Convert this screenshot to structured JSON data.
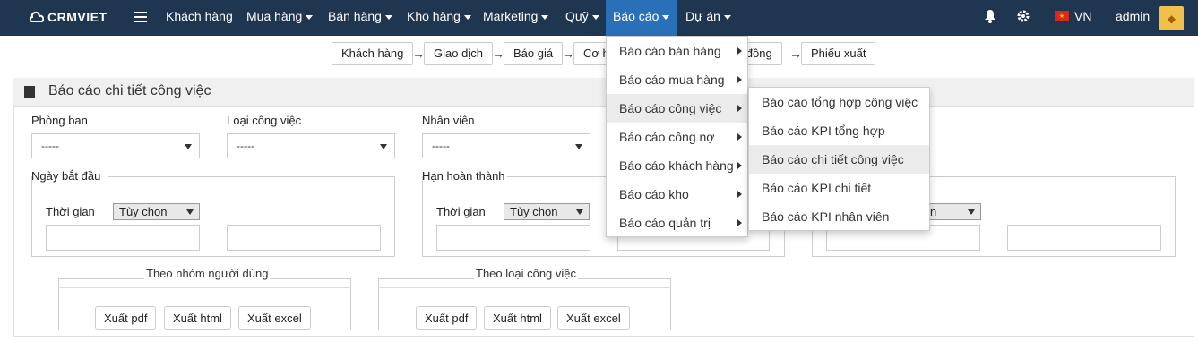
{
  "brand": {
    "name": "CRMVIET"
  },
  "nav": {
    "customers": "Khách hàng",
    "purchasing": "Mua hàng",
    "sales": "Bán hàng",
    "warehouse": "Kho hàng",
    "marketing": "Marketing",
    "fund": "Quỹ",
    "reports": "Báo cáo",
    "projects": "Dự án"
  },
  "topright": {
    "lang": "VN",
    "user": "admin"
  },
  "steps": [
    "Khách hàng",
    "Giao dịch",
    "Báo giá",
    "Cơ hội",
    "Hợp đồng",
    "Phiếu xuất"
  ],
  "page": {
    "title": "Báo cáo chi tiết công việc"
  },
  "form": {
    "department_label": "Phòng ban",
    "department_value": "-----",
    "work_type_label": "Loại công việc",
    "work_type_value": "-----",
    "employee_label": "Nhân viên",
    "employee_value": "-----",
    "start_date_label": "Ngày bắt đầu",
    "due_date_label": "Hạn hoàn thành",
    "time_label": "Thời gian",
    "time_option": "Tùy chọn",
    "time_option_partial": "chọn"
  },
  "export_groups": [
    {
      "title": "Theo nhóm người dùng",
      "pdf": "Xuất pdf",
      "html": "Xuất html",
      "excel": "Xuất excel"
    },
    {
      "title": "Theo loại công việc",
      "pdf": "Xuất pdf",
      "html": "Xuất html",
      "excel": "Xuất excel"
    }
  ],
  "reports_menu": [
    "Báo cáo bán hàng",
    "Báo cáo mua hàng",
    "Báo cáo công việc",
    "Báo cáo công nợ",
    "Báo cáo khách hàng",
    "Báo cáo kho",
    "Báo cáo quản trị"
  ],
  "work_submenu": [
    "Báo cáo tổng hợp công việc",
    "Báo cáo KPI tổng hợp",
    "Báo cáo chi tiết công việc",
    "Báo cáo KPI chi tiết",
    "Báo cáo KPI nhân viên"
  ],
  "colors": {
    "navbar": "#1f3650",
    "active_nav": "#2a70b8"
  }
}
